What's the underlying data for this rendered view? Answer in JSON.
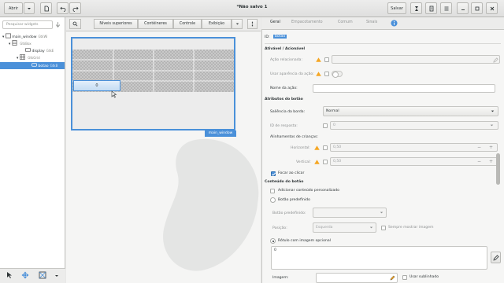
{
  "header": {
    "open_label": "Abrir",
    "title": "*Não salvo 1",
    "save_label": "Salvar"
  },
  "tree": {
    "search_placeholder": "Pesquisar widgets",
    "items": [
      {
        "label": "main_window",
        "sub": "GtkWi"
      },
      {
        "label": "",
        "sub": "GtkBox"
      },
      {
        "label": "display",
        "sub": "GtkE"
      },
      {
        "label": "",
        "sub": "GtkGrid"
      },
      {
        "label": "botao",
        "sub": "GtkB"
      }
    ]
  },
  "center": {
    "tabs": [
      "Níveis superiores",
      "Contêineres",
      "Controle",
      "Exibição"
    ],
    "preview_button_text": "0",
    "preview_window_label": "main_window"
  },
  "props": {
    "tabs": [
      "Geral",
      "Empacotamento",
      "Comum",
      "Sinais"
    ],
    "id_label": "ID:",
    "id_value": "botao",
    "section_activatable": "Ativável / Acionável",
    "related_action": "Ação relacionada:",
    "use_appearance": "Usar aparência da ação:",
    "action_name": "Nome da ação:",
    "section_button": "Atributos do botão",
    "relief_label": "Saliência da borda:",
    "relief_value": "Normal",
    "response_id": "ID de resposta:",
    "response_value": "0",
    "child_alignment": "Alinhamentos de crianças:",
    "horizontal_label": "Horizontal:",
    "horizontal_value": "0,50",
    "vertical_label": "Vertical:",
    "vertical_value": "0,50",
    "focus_on_click": "Focar ao clicar",
    "section_content": "Conteúdo do botão",
    "custom_content": "Adicionar conteúdo personalizado",
    "stock_button": "Botão predefinido",
    "stock_label": "Botão predefinido:",
    "position_label": "Posição:",
    "position_value": "Esquerda",
    "always_show_image": "Sempre mostrar imagem",
    "label_with_image": "Rótulo com imagem opcional",
    "label_value": "0",
    "image_label": "Imagem:",
    "use_underline": "Usar sublinhado"
  },
  "colors": {
    "accent": "#4a90d9",
    "warning": "#f5a623"
  }
}
